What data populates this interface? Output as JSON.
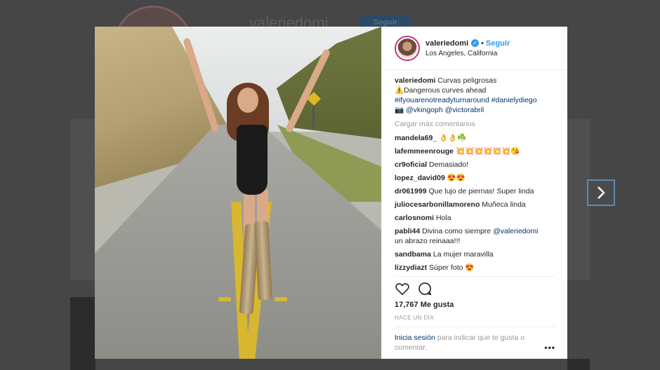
{
  "background": {
    "username": "valeriedomi",
    "follow_label": "Seguir"
  },
  "post": {
    "username": "valeriedomi",
    "verified_icon": "verified-badge-icon",
    "separator": "•",
    "follow_label": "Seguir",
    "location": "Los Angeles, California",
    "caption": {
      "user": "valeriedomi",
      "line1": "Curvas peligrosas",
      "line2": "⚠️Dangerous curves ahead",
      "hashtag1": "#ifyouarenotreadyturnaround",
      "hashtag2": "#danielydiego",
      "line4_prefix": "📷",
      "mention1": "@vkingoph",
      "mention2": "@victorabril"
    },
    "load_more": "Cargar más comentarios",
    "comments": [
      {
        "user": "mandela69_",
        "text": "👌👌☘️"
      },
      {
        "user": "lafemmeenrouge",
        "text": "💥💥💥💥💥💥😘"
      },
      {
        "user": "cr9oficial",
        "text": "Demasiado!"
      },
      {
        "user": "lopez_david09",
        "text": "😍😍"
      },
      {
        "user": "dr061999",
        "text": "Que lujo de piernas! Super linda"
      },
      {
        "user": "juliocesarbonillamoreno",
        "text": "Muñeca linda"
      },
      {
        "user": "carlosnomi",
        "text": "Hola"
      },
      {
        "user": "pabli44",
        "text": "Divina como siempre",
        "mention": "@valeriedomi",
        "text2": "un abrazo reinaaa!!!"
      },
      {
        "user": "sandbama",
        "text": "La mujer maravilla"
      },
      {
        "user": "lizzydiazt",
        "text": "Súper foto 😍"
      }
    ],
    "likes": "17,767 Me gusta",
    "time": "HACE UN DÍA",
    "login_link": "Inicia sesión",
    "login_text": " para indicar que te gusta o comentar.",
    "more_label": "•••"
  },
  "icons": {
    "like": "heart-icon",
    "comment": "comment-icon",
    "next": "chevron-right-icon"
  }
}
